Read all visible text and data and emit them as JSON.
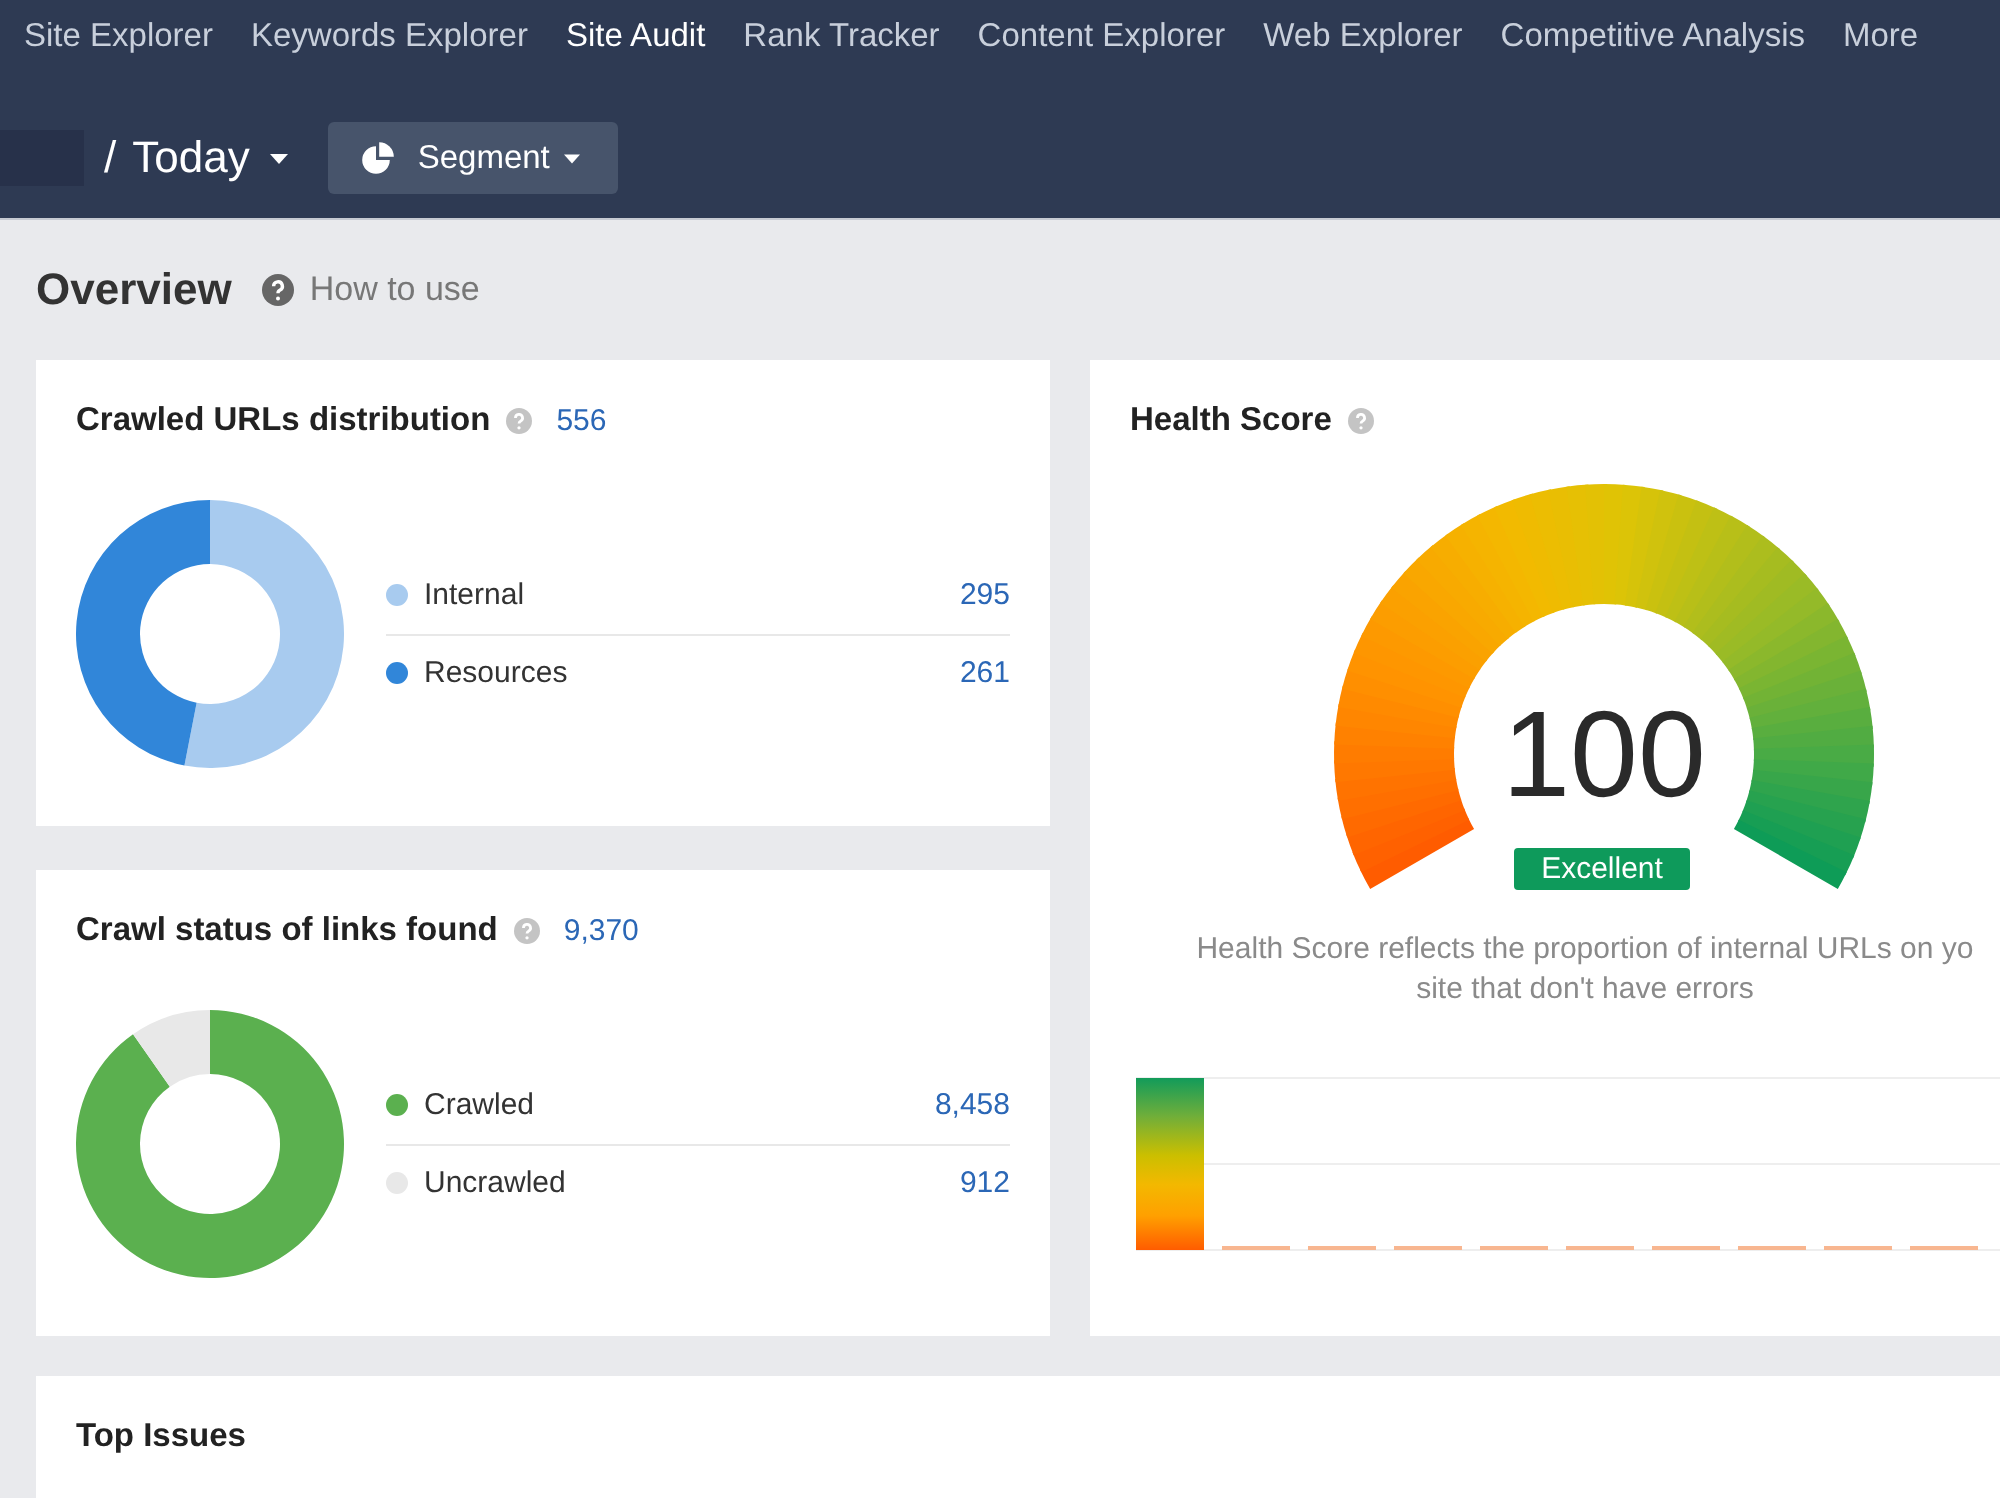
{
  "nav": {
    "items": [
      {
        "label": "Site Explorer",
        "selected": false
      },
      {
        "label": "Keywords Explorer",
        "selected": false
      },
      {
        "label": "Site Audit",
        "selected": true
      },
      {
        "label": "Rank Tracker",
        "selected": false
      },
      {
        "label": "Content Explorer",
        "selected": false
      },
      {
        "label": "Web Explorer",
        "selected": false
      },
      {
        "label": "Competitive Analysis",
        "selected": false
      },
      {
        "label": "More",
        "selected": false
      }
    ]
  },
  "toolbar": {
    "separator": "/",
    "date": "Today",
    "segment_button": "Segment"
  },
  "overview": {
    "title": "Overview",
    "help_link": "How to use"
  },
  "cards": [
    {
      "title": "Crawled URLs distribution",
      "total": "556",
      "chart_data": {
        "type": "donut",
        "categories": [
          "Internal",
          "Resources"
        ],
        "values": [
          295,
          261
        ],
        "value_labels": [
          "295",
          "261"
        ],
        "legend": "right"
      },
      "legend_dots": [
        {
          "color": "#a8cbef"
        },
        {
          "color": "#3186d9"
        }
      ]
    },
    {
      "title": "Crawl status of links found",
      "total": "9,370",
      "chart_data": {
        "type": "donut",
        "categories": [
          "Crawled",
          "Uncrawled"
        ],
        "values": [
          8458,
          912
        ],
        "value_labels": [
          "8,458",
          "912"
        ],
        "legend": "right"
      },
      "legend_dots": [
        {
          "color": "#5bb04f"
        },
        {
          "color": "#e8e8e8"
        }
      ]
    }
  ],
  "health_score": {
    "title": "Health Score",
    "score": "100",
    "rating": "Excellent",
    "description": "Health Score reflects the proportion of internal URLs on yo\nsite that don't have errors"
  },
  "top_issues": {
    "title": "Top Issues"
  }
}
